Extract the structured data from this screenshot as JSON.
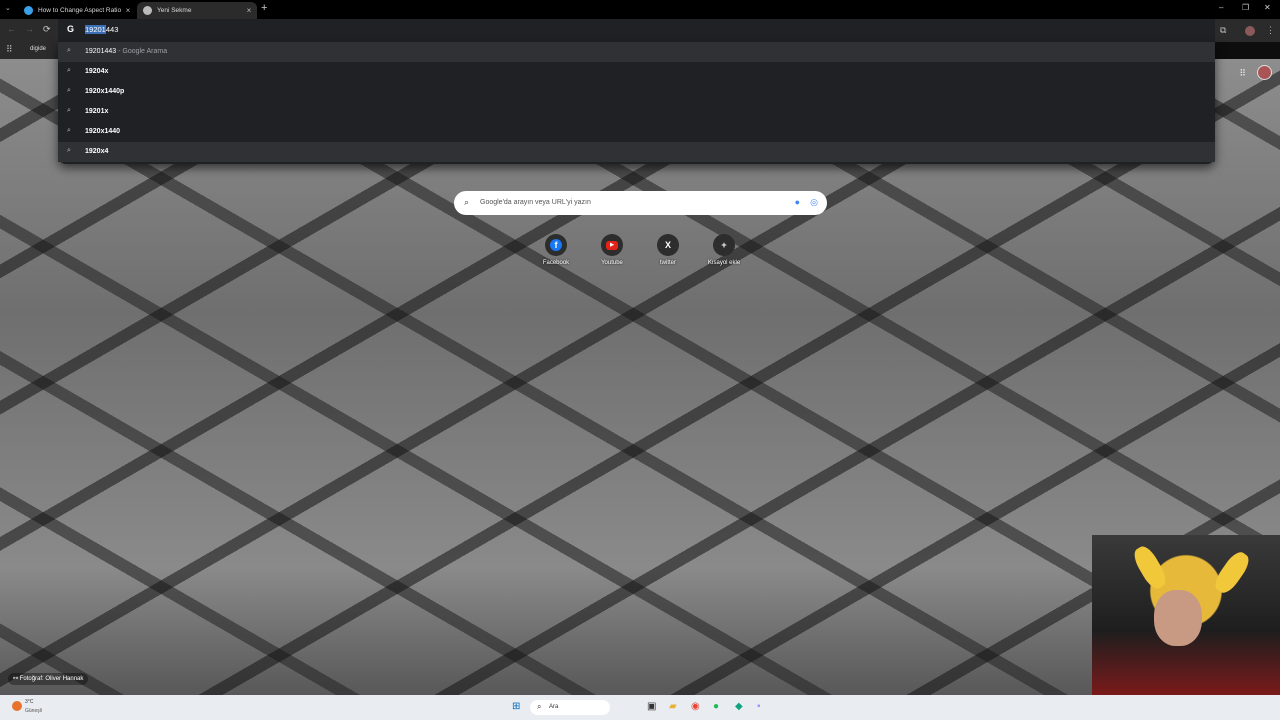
{
  "tabs": [
    {
      "title": "How to Change Aspect Ratio in",
      "close": "×",
      "favicon_color": "#3aa0e8"
    },
    {
      "title": "Yeni Sekme",
      "close": "×",
      "favicon_color": "#bbbbbb"
    }
  ],
  "tab_search_icon": "chevron-down-icon",
  "new_tab": "+",
  "window_controls": {
    "minimize": "–",
    "restore": "❐",
    "close": "✕"
  },
  "toolbar": {
    "back": "←",
    "forward": "→",
    "reload": "⟳",
    "extensions": "⧉",
    "menu": "⋮"
  },
  "omnibox": {
    "engine_icon": "G",
    "query_selected": "19201",
    "query_rest": "443"
  },
  "bookmarks": {
    "apps": "⠿",
    "item": "digide"
  },
  "suggestions": [
    {
      "text": "19201443",
      "sub": " - Google Arama"
    },
    {
      "text": "19204x",
      "sub": ""
    },
    {
      "text": "1920x1440p",
      "sub": ""
    },
    {
      "text": "19201x",
      "sub": ""
    },
    {
      "text": "1920x1440",
      "sub": ""
    },
    {
      "text": "1920x4",
      "sub": ""
    }
  ],
  "ntp": {
    "search_placeholder": "Google'da arayın veya URL'yi yazın",
    "shortcuts": [
      {
        "icon": "f",
        "label": "Facebook",
        "color": "#1877f2"
      },
      {
        "icon": "▶",
        "label": "Youtube",
        "color": "#e62117"
      },
      {
        "icon": "X",
        "label": "twitter",
        "color": "#2d2d2d"
      },
      {
        "icon": "+",
        "label": "Kısayol ekle",
        "color": "#2d2d2d"
      }
    ],
    "photo_credit": "Fotoğraf: Oliver Hannak",
    "apps_icon": "⠿"
  },
  "taskbar": {
    "temp": "3°C",
    "weather": "Güneşli",
    "search": "Ara",
    "start": "⊞"
  }
}
